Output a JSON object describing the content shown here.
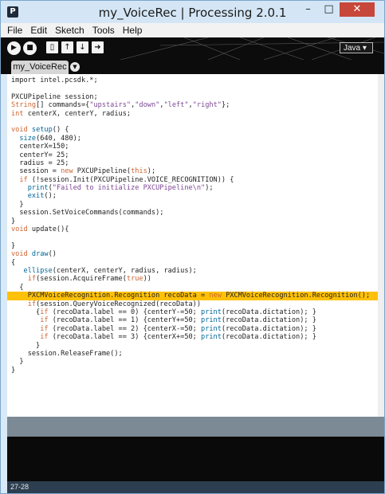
{
  "window": {
    "title": "my_VoiceRec | Processing 2.0.1",
    "app_icon": "P",
    "minimize": "–",
    "maximize": "□",
    "close": "✕"
  },
  "menu": [
    "File",
    "Edit",
    "Sketch",
    "Tools",
    "Help"
  ],
  "toolbar": {
    "run_icon": "play-icon",
    "stop_icon": "stop-icon",
    "new_icon": "new-file-icon",
    "open_icon": "open-icon",
    "save_icon": "save-icon",
    "export_icon": "export-icon",
    "mode": "Java ▾"
  },
  "tabs": [
    {
      "label": "my_VoiceRec"
    }
  ],
  "tab_menu": "▼",
  "code": [
    [
      [
        "",
        "import intel.pcsdk.*;"
      ]
    ],
    [],
    [
      [
        "",
        "PXCUPipeline session;"
      ]
    ],
    [
      [
        "type",
        "String"
      ],
      [
        "",
        "[] commands={"
      ],
      [
        "str",
        "\"upstairs\""
      ],
      [
        "",
        ","
      ],
      [
        "str",
        "\"down\""
      ],
      [
        "",
        ","
      ],
      [
        "str",
        "\"left\""
      ],
      [
        "",
        ","
      ],
      [
        "str",
        "\"right\""
      ],
      [
        "",
        "};"
      ]
    ],
    [
      [
        "kw",
        "int"
      ],
      [
        "",
        " centerX, centerY, radius;"
      ]
    ],
    [],
    [
      [
        "kw",
        "void"
      ],
      [
        "",
        " "
      ],
      [
        "fn",
        "setup"
      ],
      [
        "",
        "() {"
      ]
    ],
    [
      [
        "",
        "  "
      ],
      [
        "fn2",
        "size"
      ],
      [
        "",
        "(640, 480);"
      ]
    ],
    [
      [
        "",
        "  centerX=150;"
      ]
    ],
    [
      [
        "",
        "  centerY= 25;"
      ]
    ],
    [
      [
        "",
        "  radius = 25;"
      ]
    ],
    [
      [
        "",
        "  session = "
      ],
      [
        "kw",
        "new"
      ],
      [
        "",
        " PXCUPipeline("
      ],
      [
        "kw",
        "this"
      ],
      [
        "",
        ");"
      ]
    ],
    [
      [
        "",
        "  "
      ],
      [
        "kw",
        "if"
      ],
      [
        "",
        " (!session.Init(PXCUPipeline.VOICE_RECOGNITION)) {"
      ]
    ],
    [
      [
        "",
        "    "
      ],
      [
        "fn2",
        "print"
      ],
      [
        "",
        "("
      ],
      [
        "str",
        "\"Failed to initialize PXCUPipeline\\n\""
      ],
      [
        "",
        ");"
      ]
    ],
    [
      [
        "",
        "    "
      ],
      [
        "fn2",
        "exit"
      ],
      [
        "",
        "();"
      ]
    ],
    [
      [
        "",
        "  }"
      ]
    ],
    [
      [
        "",
        "  session.SetVoiceCommands(commands);"
      ]
    ],
    [
      [
        "",
        "}"
      ]
    ],
    [
      [
        "kw",
        "void"
      ],
      [
        "",
        " update(){"
      ]
    ],
    [],
    [
      [
        "",
        "}"
      ]
    ],
    [
      [
        "kw",
        "void"
      ],
      [
        "",
        " "
      ],
      [
        "fn",
        "draw"
      ],
      [
        "",
        "()"
      ]
    ],
    [
      [
        "",
        "{"
      ]
    ],
    [
      [
        "",
        "   "
      ],
      [
        "fn2",
        "ellipse"
      ],
      [
        "",
        "(centerX, centerY, radius, radius);"
      ]
    ],
    [
      [
        "",
        "    "
      ],
      [
        "kw",
        "if"
      ],
      [
        "",
        "(session.AcquireFrame("
      ],
      [
        "kw",
        "true"
      ],
      [
        "",
        "))"
      ]
    ],
    [
      [
        "",
        "  {"
      ]
    ],
    [
      [
        "",
        "    PXCMVoiceRecognition.Recognition recoData = "
      ],
      [
        "kw",
        "new"
      ],
      [
        "",
        " PXCMVoiceRecognition.Recognition();"
      ]
    ],
    [
      [
        "",
        "    "
      ],
      [
        "kw",
        "if"
      ],
      [
        "",
        "(session.QueryVoiceRecognized(recoData))"
      ]
    ],
    [
      [
        "",
        "      {"
      ],
      [
        "kw",
        "if"
      ],
      [
        "",
        " (recoData.label == 0) {centerY-=50; "
      ],
      [
        "fn2",
        "print"
      ],
      [
        "",
        "(recoData.dictation); }"
      ]
    ],
    [
      [
        "",
        "       "
      ],
      [
        "kw",
        "if"
      ],
      [
        "",
        " (recoData.label == 1) {centerY+=50; "
      ],
      [
        "fn2",
        "print"
      ],
      [
        "",
        "(recoData.dictation); }"
      ]
    ],
    [
      [
        "",
        "       "
      ],
      [
        "kw",
        "if"
      ],
      [
        "",
        " (recoData.label == 2) {centerX-=50; "
      ],
      [
        "fn2",
        "print"
      ],
      [
        "",
        "(recoData.dictation); }"
      ]
    ],
    [
      [
        "",
        "       "
      ],
      [
        "kw",
        "if"
      ],
      [
        "",
        " (recoData.label == 3) {centerX+=50; "
      ],
      [
        "fn2",
        "print"
      ],
      [
        "",
        "(recoData.dictation); }"
      ]
    ],
    [
      [
        "",
        "      }"
      ]
    ],
    [
      [
        "",
        "    session.ReleaseFrame();"
      ]
    ],
    [
      [
        "",
        "  }"
      ]
    ],
    [
      [
        "",
        "}"
      ]
    ]
  ],
  "highlight_line": 26,
  "status": {
    "line_range": "27-28"
  },
  "colors": {
    "highlight": "#ffc107",
    "keyword": "#cc6633",
    "function": "#006699",
    "string": "#7d4793"
  }
}
